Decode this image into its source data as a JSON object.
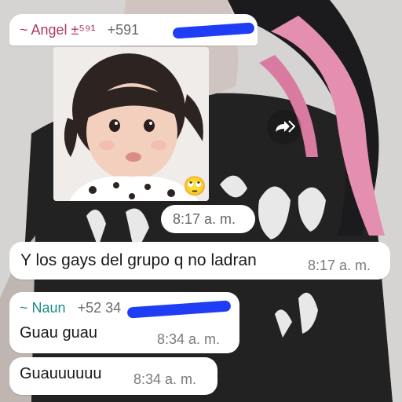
{
  "colors": {
    "angel_name": "#b03a5b",
    "naun_name": "#1e8a8a",
    "bubble_bg": "#ffffff",
    "time_text": "#7a7a7a",
    "redaction": "#1e3df5"
  },
  "messages": [
    {
      "sender_name": "~ Angel ±⁵⁹¹",
      "sender_phone": "+591",
      "media_emoji": "🙄",
      "media_icon": "child-photo",
      "time": "8:17 a. m."
    },
    {
      "text": "Y los gays del grupo q no ladran",
      "time": "8:17 a. m."
    },
    {
      "sender_name": "~ Naun",
      "sender_phone": "+52 34",
      "text": "Guau guau",
      "time": "8:34 a. m."
    },
    {
      "text": "Guauuuuuu",
      "time": "8:34 a. m."
    }
  ],
  "icons": {
    "forward": "forward-icon"
  }
}
